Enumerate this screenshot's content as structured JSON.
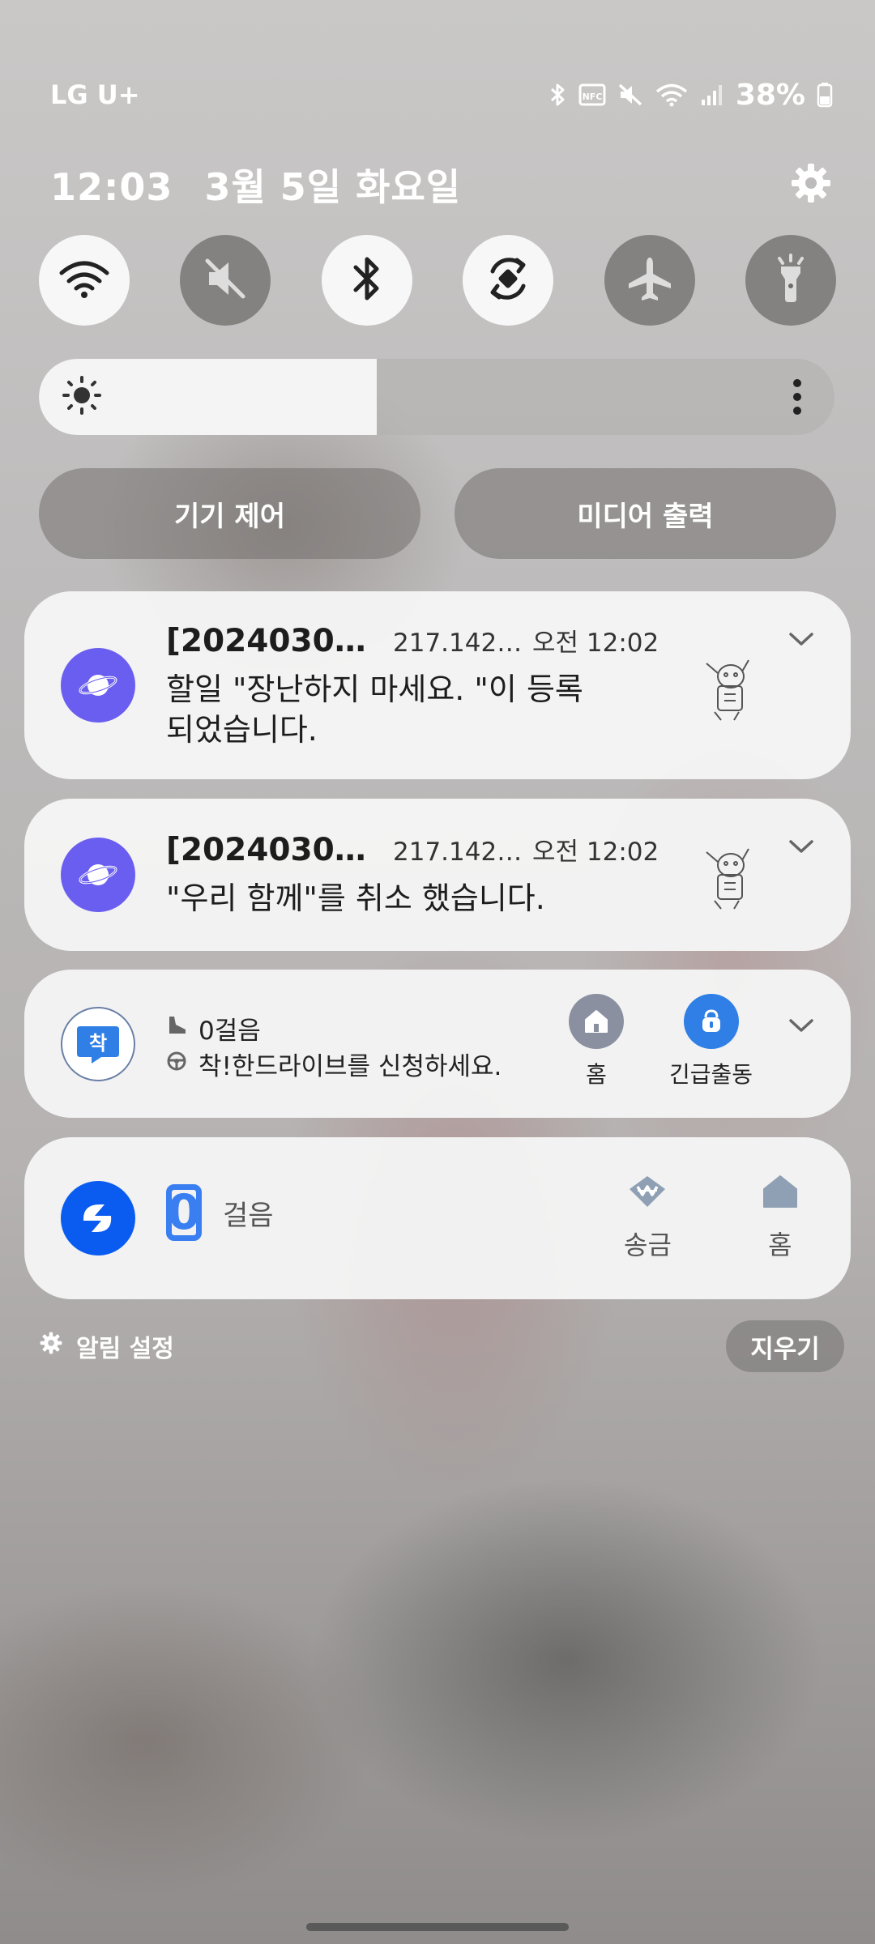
{
  "status_bar": {
    "carrier": "LG U+",
    "battery_percent": "38%",
    "icons": [
      "bluetooth-icon",
      "nfc-icon",
      "mute-icon",
      "wifi-icon",
      "signal-icon",
      "battery-icon"
    ]
  },
  "header": {
    "time": "12:03",
    "date": "3월 5일 화요일",
    "settings_icon": "gear-icon"
  },
  "quick_settings": [
    {
      "name": "wifi",
      "state": "on"
    },
    {
      "name": "sound-mute",
      "state": "off"
    },
    {
      "name": "bluetooth",
      "state": "on"
    },
    {
      "name": "auto-rotate",
      "state": "on"
    },
    {
      "name": "airplane-mode",
      "state": "off"
    },
    {
      "name": "flashlight",
      "state": "off"
    }
  ],
  "brightness": {
    "level": 0.425
  },
  "buttons": {
    "device_control": "기기 제어",
    "media_output": "미디어 출력"
  },
  "notifications": [
    {
      "title": "[2024030…",
      "source": "217.142…",
      "time": "오전 12:02",
      "body": "할일 \"장난하지 마세요. \"이 등록 되었습니다."
    },
    {
      "title": "[2024030…",
      "source": "217.142…",
      "time": "오전 12:02",
      "body": "\"우리 함께\"를 취소 했습니다."
    }
  ],
  "drive_card": {
    "app_icon_text": "착",
    "steps": "0걸음",
    "message": "착!한드라이브를 신청하세요.",
    "action_home": "홈",
    "action_emergency": "긴급출동",
    "accent": "#2f7fe6"
  },
  "steps_card": {
    "count": "0",
    "unit": "걸음",
    "action_send": "송금",
    "action_home": "홈",
    "accent": "#0a5cf0"
  },
  "footer": {
    "notification_settings": "알림 설정",
    "clear": "지우기"
  }
}
